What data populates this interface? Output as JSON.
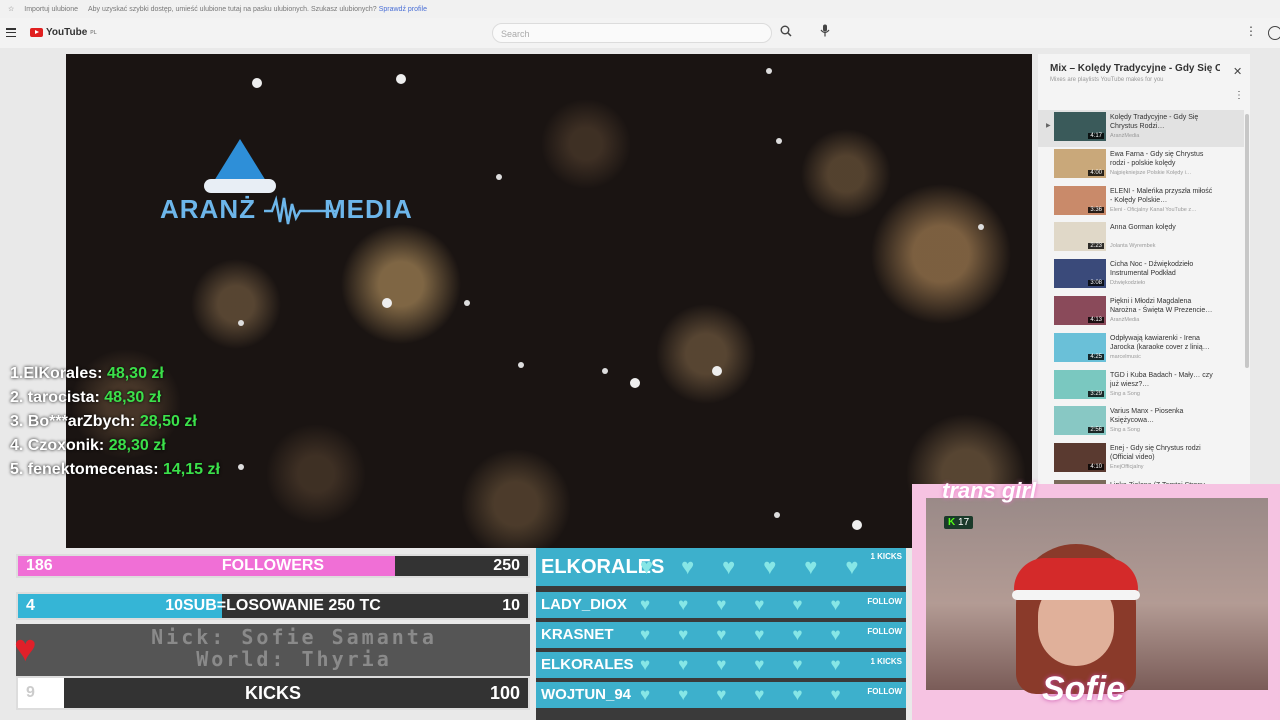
{
  "browser": {
    "bookmark_import": "Importuj ulubione",
    "bookmark_hint": "Aby uzyskać szybki dostęp, umieść ulubione tutaj na pasku ulubionych. Szukasz ulubionych?",
    "bookmark_link": "Sprawdź profile"
  },
  "header": {
    "logo": "YouTube",
    "logo_sup": "PL",
    "search_placeholder": "Search"
  },
  "video": {
    "logo_left": "ARANŻ",
    "logo_right": "MEDIA",
    "leaderboard": [
      {
        "rank": "1.",
        "name": "ElKorales:",
        "amount": "48,30 zł"
      },
      {
        "rank": "2.",
        "name": "tarocista:",
        "amount": "48,30 zł"
      },
      {
        "rank": "3.",
        "name": "Bo***arZbych:",
        "amount": "28,50 zł"
      },
      {
        "rank": "4.",
        "name": "Czoxonik:",
        "amount": "28,30 zł"
      },
      {
        "rank": "5.",
        "name": "fenektomecenas:",
        "amount": "14,15 zł"
      }
    ]
  },
  "playlist": {
    "title": "Mix – Kolędy Tradycyjne - Gdy Się Chrystus Rodzi",
    "subtitle": "Mixes are playlists YouTube makes for you",
    "items": [
      {
        "title": "Kolędy Tradycyjne - Gdy Się Chrystus Rodzi…",
        "channel": "AranżMedia",
        "duration": "4:17",
        "active": true,
        "thumb": "#3a5a5a"
      },
      {
        "title": "Ewa Farna - Gdy się Chrystus rodzi - polskie kolędy",
        "channel": "Najpiękniejsze Polskie Kolędy i…",
        "duration": "4:00",
        "thumb": "#c9a87a"
      },
      {
        "title": "ELENI - Maleńka przyszła miłość - Kolędy Polskie…",
        "channel": "Eleni - Oficjalny Kanał YouTube z…",
        "duration": "3:36",
        "thumb": "#c98a6a"
      },
      {
        "title": "Anna Gorman kolędy",
        "channel": "Jolanta Wyrembek",
        "duration": "2:23",
        "thumb": "#e0d8c8"
      },
      {
        "title": "Cicha Noc - Dźwiękodzieło Instrumental Podkład",
        "channel": "Dźwiękodzieło",
        "duration": "3:08",
        "thumb": "#3a4a7a"
      },
      {
        "title": "Piękni i Młodzi Magdalena Narożna - Święta W Prezencie…",
        "channel": "AranżMedia",
        "duration": "4:13",
        "thumb": "#8a4a5a"
      },
      {
        "title": "Odpływają kawiarenki - Irena Jarocka (karaoke cover z linią…",
        "channel": "marcelmusic",
        "duration": "4:25",
        "thumb": "#6ac0d8"
      },
      {
        "title": "TGD i Kuba Badach - Mały… czy już wiesz?…",
        "channel": "Sing a Song",
        "duration": "3:29",
        "thumb": "#7ac8c0"
      },
      {
        "title": "Varius Manx - Piosenka Księżycowa…",
        "channel": "Sing a Song",
        "duration": "2:56",
        "thumb": "#88c8c4"
      },
      {
        "title": "Enej - Gdy się Chrystus rodzi (Official video)",
        "channel": "EnejOfficjalny",
        "duration": "4:10",
        "thumb": "#5a3a30"
      },
      {
        "title": "Lipka Zielona (Z Tamtej Strony…",
        "channel": "",
        "duration": "",
        "thumb": "#7a6a5a"
      }
    ]
  },
  "goals": {
    "followers": {
      "current": "186",
      "label": "FOLLOWERS",
      "target": "250",
      "progress": 0.74,
      "color": "#f06fd6"
    },
    "subs": {
      "current": "4",
      "label": "10SUB=LOSOWANIE 250 TC",
      "target": "10",
      "progress": 0.4,
      "color": "#35b5d6"
    },
    "kicks": {
      "current": "9",
      "label": "KICKS",
      "target": "100",
      "progress": 0.09,
      "color": "#ffffff"
    }
  },
  "nick": {
    "line1": "Nick: Sofie Samanta",
    "line2": "World: Thyria"
  },
  "kick_events": [
    {
      "name": "ELKORALES",
      "tag": "1 KICKS"
    },
    {
      "name": "LADY_DIOX",
      "tag": "FOLLOW"
    },
    {
      "name": "KRASNET",
      "tag": "FOLLOW"
    },
    {
      "name": "ELKORALES",
      "tag": "1 KICKS"
    },
    {
      "name": "WOJTUN_94",
      "tag": "FOLLOW"
    }
  ],
  "camera": {
    "top_text": "trans girl",
    "name": "Sofie",
    "kick_level": "17",
    "kick_icon": "K"
  }
}
